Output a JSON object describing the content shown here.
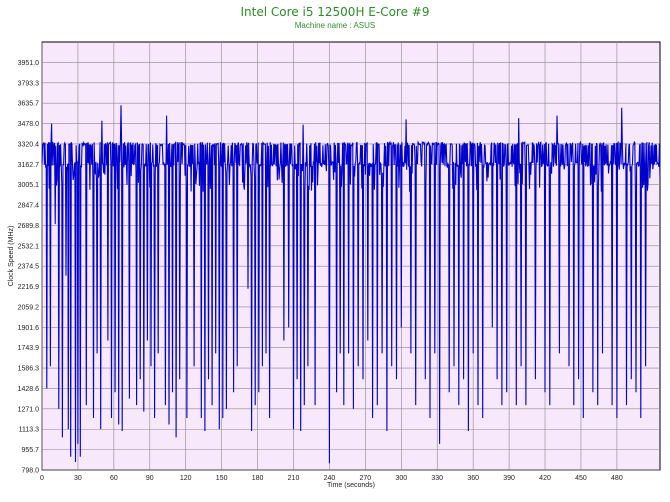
{
  "chart_data": {
    "type": "line",
    "title": "Intel Core i5 12500H E-Core #9",
    "subtitle": "Machine name : ASUS",
    "xlabel": "Time (seconds)",
    "ylabel": "Clock Speed (MHz)",
    "xlim": [
      0,
      516
    ],
    "ylim": [
      798.0,
      4109.0
    ],
    "x_ticks": [
      0,
      30,
      60,
      90,
      120,
      150,
      180,
      210,
      240,
      270,
      300,
      330,
      360,
      390,
      420,
      450,
      480
    ],
    "y_ticks": [
      "798.0",
      "955.7",
      "1113.3",
      "1271.0",
      "1428.6",
      "1586.3",
      "1743.9",
      "1901.6",
      "2059.2",
      "2216.9",
      "2374.5",
      "2532.1",
      "2689.8",
      "2847.4",
      "3005.1",
      "3162.7",
      "3320.4",
      "3478.0",
      "3635.7",
      "3793.3",
      "3951.0"
    ],
    "grid": true,
    "legend": "none",
    "series": [
      {
        "color": "#0000cc",
        "base_high": 3162.7,
        "top_high": 3320.4,
        "dips": [
          [
            4,
            1428.6
          ],
          [
            7,
            1600
          ],
          [
            11,
            2700
          ],
          [
            14,
            1271.0
          ],
          [
            17,
            1050
          ],
          [
            20,
            2300
          ],
          [
            22,
            1113.3
          ],
          [
            24,
            900
          ],
          [
            26,
            1050
          ],
          [
            28,
            860
          ],
          [
            30,
            1000
          ],
          [
            32,
            900
          ],
          [
            34,
            1100
          ],
          [
            37,
            1300
          ],
          [
            40,
            1050
          ],
          [
            43,
            1200
          ],
          [
            46,
            1700
          ],
          [
            49,
            1113.3
          ],
          [
            52,
            1500
          ],
          [
            55,
            1800
          ],
          [
            58,
            1200
          ],
          [
            61,
            1400
          ],
          [
            64,
            1150
          ],
          [
            67,
            1100
          ],
          [
            70,
            1450
          ],
          [
            73,
            1350
          ],
          [
            76,
            1150
          ],
          [
            79,
            1300
          ],
          [
            82,
            1500
          ],
          [
            85,
            1250
          ],
          [
            88,
            1800
          ],
          [
            91,
            1600
          ],
          [
            94,
            1200
          ],
          [
            97,
            1700
          ],
          [
            100,
            1500
          ],
          [
            103,
            1300
          ],
          [
            106,
            1150
          ],
          [
            109,
            1400
          ],
          [
            112,
            1050
          ],
          [
            115,
            1500
          ],
          [
            118,
            1900
          ],
          [
            121,
            1200
          ],
          [
            124,
            1300
          ],
          [
            127,
            1600
          ],
          [
            130,
            1350
          ],
          [
            133,
            1200
          ],
          [
            136,
            1100
          ],
          [
            139,
            1500
          ],
          [
            142,
            1300
          ],
          [
            145,
            1700
          ],
          [
            148,
            1113.3
          ],
          [
            151,
            1200
          ],
          [
            154,
            1271.0
          ],
          [
            157,
            1500
          ],
          [
            160,
            1400
          ],
          [
            163,
            1600
          ],
          [
            166,
            1800
          ],
          [
            169,
            1300
          ],
          [
            172,
            2200
          ],
          [
            175,
            1100
          ],
          [
            178,
            1300
          ],
          [
            181,
            1400
          ],
          [
            184,
            1600
          ],
          [
            187,
            1700
          ],
          [
            190,
            1200
          ],
          [
            193,
            1500
          ],
          [
            196,
            1300
          ],
          [
            199,
            2500
          ],
          [
            202,
            1800
          ],
          [
            206,
            1900
          ],
          [
            210,
            1113.3
          ],
          [
            213,
            1500
          ],
          [
            216,
            1100
          ],
          [
            219,
            1300
          ],
          [
            222,
            1600
          ],
          [
            225,
            1200
          ],
          [
            228,
            1300
          ],
          [
            231,
            1113.3
          ],
          [
            234,
            1200
          ],
          [
            237,
            1500
          ],
          [
            240,
            850
          ],
          [
            243,
            1300
          ],
          [
            246,
            1400
          ],
          [
            249,
            1700
          ],
          [
            252,
            1300
          ],
          [
            256,
            1700
          ],
          [
            260,
            1271.0
          ],
          [
            264,
            1600
          ],
          [
            268,
            1500
          ],
          [
            272,
            1800
          ],
          [
            276,
            1200
          ],
          [
            280,
            1300
          ],
          [
            284,
            1700
          ],
          [
            288,
            1100
          ],
          [
            292,
            1600
          ],
          [
            296,
            1500
          ],
          [
            300,
            1900
          ],
          [
            304,
            1200
          ],
          [
            308,
            1700
          ],
          [
            312,
            1300
          ],
          [
            316,
            1800
          ],
          [
            320,
            1500
          ],
          [
            324,
            1200
          ],
          [
            328,
            1700
          ],
          [
            332,
            1000
          ],
          [
            336,
            1300
          ],
          [
            340,
            1400
          ],
          [
            344,
            1600
          ],
          [
            348,
            1300
          ],
          [
            352,
            1500
          ],
          [
            356,
            1100
          ],
          [
            360,
            1700
          ],
          [
            364,
            1300
          ],
          [
            368,
            1200
          ],
          [
            372,
            1700
          ],
          [
            376,
            1900
          ],
          [
            380,
            1500
          ],
          [
            384,
            1300
          ],
          [
            388,
            1400
          ],
          [
            392,
            1800
          ],
          [
            396,
            1300
          ],
          [
            400,
            1600
          ],
          [
            404,
            1300
          ],
          [
            408,
            1100
          ],
          [
            412,
            1500
          ],
          [
            416,
            1700
          ],
          [
            420,
            1400
          ],
          [
            424,
            1300
          ],
          [
            428,
            1200
          ],
          [
            432,
            1700
          ],
          [
            436,
            850
          ],
          [
            440,
            1600
          ],
          [
            444,
            1300
          ],
          [
            448,
            1500
          ],
          [
            452,
            1200
          ],
          [
            456,
            1700
          ],
          [
            460,
            1400
          ],
          [
            464,
            1300
          ],
          [
            468,
            1700
          ],
          [
            472,
            1500
          ],
          [
            476,
            1300
          ],
          [
            480,
            1200
          ],
          [
            484,
            1600
          ],
          [
            488,
            1300
          ],
          [
            492,
            1500
          ],
          [
            496,
            1400
          ],
          [
            500,
            1200
          ],
          [
            504,
            1600
          ],
          [
            508,
            1800
          ],
          [
            512,
            1300
          ]
        ],
        "spikes": [
          [
            8,
            3478.0
          ],
          [
            50,
            3500
          ],
          [
            66,
            3620
          ],
          [
            104,
            3540
          ],
          [
            160,
            3500
          ],
          [
            218,
            3470
          ],
          [
            304,
            3510
          ],
          [
            340,
            3520
          ],
          [
            398,
            3520
          ],
          [
            430,
            3540
          ],
          [
            476,
            3530
          ],
          [
            484,
            3600
          ],
          [
            500,
            3430
          ]
        ]
      }
    ]
  }
}
